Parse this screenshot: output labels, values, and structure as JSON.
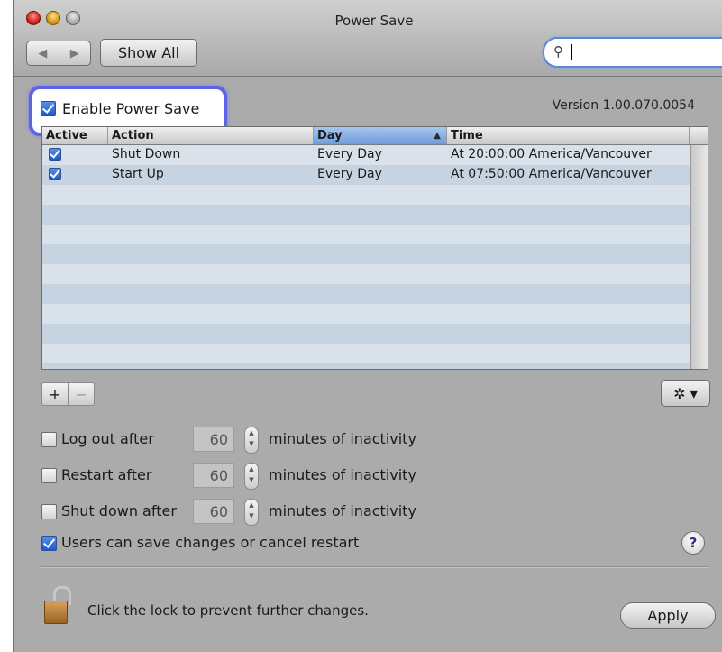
{
  "window": {
    "title": "Power Save"
  },
  "toolbar": {
    "back_glyph": "◀",
    "forward_glyph": "▶",
    "show_all": "Show All",
    "search_value": ""
  },
  "enable": {
    "label": "Enable Power Save",
    "checked": true
  },
  "version": "Version 1.00.070.0054",
  "table": {
    "columns": [
      "Active",
      "Action",
      "Day",
      "Time"
    ],
    "sorted_column": "Day",
    "rows": [
      {
        "active": true,
        "action": "Shut Down",
        "day": "Every Day",
        "time": "At 20:00:00 America/Vancouver"
      },
      {
        "active": true,
        "action": "Start Up",
        "day": "Every Day",
        "time": "At 07:50:00 America/Vancouver"
      }
    ]
  },
  "table_controls": {
    "add": "+",
    "remove": "−",
    "gear": "✲ ▾"
  },
  "options": [
    {
      "label": "Log out after",
      "value": "60",
      "suffix": "minutes of inactivity",
      "checked": false
    },
    {
      "label": "Restart after",
      "value": "60",
      "suffix": "minutes of inactivity",
      "checked": false
    },
    {
      "label": "Shut down after",
      "value": "60",
      "suffix": "minutes of inactivity",
      "checked": false
    }
  ],
  "users_option": {
    "label": "Users can save changes or cancel restart",
    "checked": true
  },
  "help": "?",
  "footer": {
    "lock_text": "Click the lock to prevent further changes.",
    "apply": "Apply"
  },
  "colors": {
    "highlight": "#5d63e6",
    "stripe": "#c6d3e0",
    "row": "#d9e1ea"
  }
}
